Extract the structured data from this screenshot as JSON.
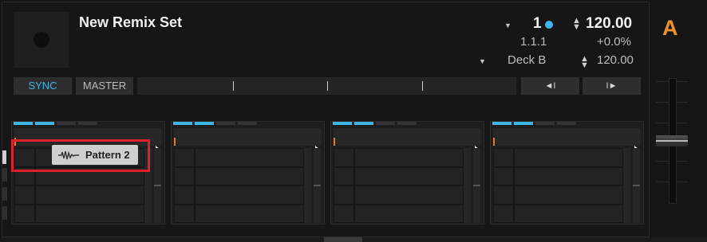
{
  "deck": {
    "title": "New Remix Set",
    "deck_letter": "A",
    "beat_indicator": "1",
    "tempo": "120.00",
    "position": "1.1.1",
    "pitch": "+0.0%",
    "sync_source": "Deck B",
    "master_tempo": "120.00"
  },
  "buttons": {
    "sync": "SYNC",
    "master": "MASTER",
    "prev_beat": "◄I",
    "next_beat": "I►"
  },
  "remix": {
    "slot_count": 4,
    "selected_sample": "Pattern 2"
  },
  "colors": {
    "accent_blue": "#3fb6e8",
    "deck_orange": "#f0922a",
    "highlight_red": "#e0202a"
  }
}
